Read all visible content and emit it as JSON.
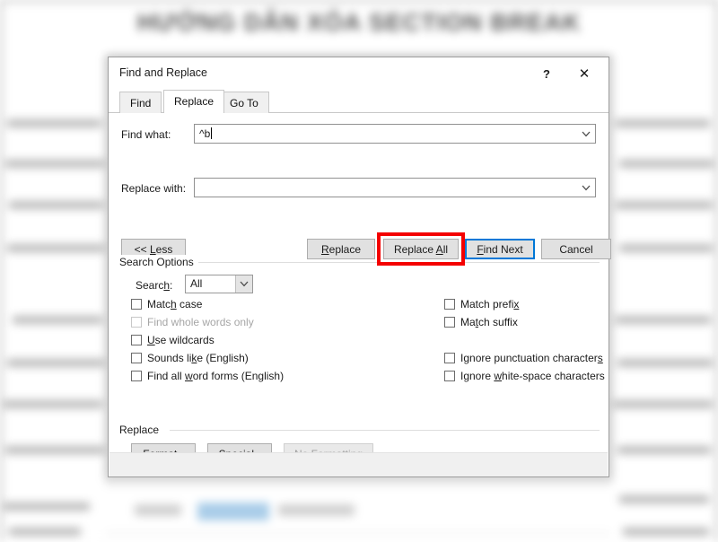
{
  "background": {
    "document_title": "HƯỚNG DẪN XÓA SECTION BREAK"
  },
  "dialog": {
    "title": "Find and Replace",
    "help_icon": "?",
    "close_icon": "✕",
    "tabs": [
      {
        "label": "Find",
        "active": false
      },
      {
        "label": "Replace",
        "active": true
      },
      {
        "label": "Go To",
        "active": false
      }
    ],
    "fields": {
      "find_what_label": "Find what:",
      "find_what_value": "^b",
      "replace_with_label": "Replace with:",
      "replace_with_value": "",
      "dropdown_icon": "chevron-down-icon"
    },
    "buttons": {
      "less": "<< Less",
      "replace": "Replace",
      "replace_all": "Replace All",
      "find_next": "Find Next",
      "cancel": "Cancel"
    },
    "search_options": {
      "group_label": "Search Options",
      "search_label": "Search:",
      "search_value": "All",
      "left_checkboxes": [
        {
          "label": "Match case",
          "checked": false,
          "disabled": false
        },
        {
          "label": "Find whole words only",
          "checked": false,
          "disabled": true
        },
        {
          "label": "Use wildcards",
          "checked": false,
          "disabled": false
        },
        {
          "label": "Sounds like (English)",
          "checked": false,
          "disabled": false
        },
        {
          "label": "Find all word forms (English)",
          "checked": false,
          "disabled": false
        }
      ],
      "right_checkboxes": [
        {
          "label": "Match prefix",
          "checked": false,
          "disabled": false
        },
        {
          "label": "Match suffix",
          "checked": false,
          "disabled": false
        },
        {
          "label": "Ignore punctuation characters",
          "checked": false,
          "disabled": false
        },
        {
          "label": "Ignore white-space characters",
          "checked": false,
          "disabled": false
        }
      ]
    },
    "replace_group": {
      "group_label": "Replace",
      "format_button": "Format",
      "special_button": "Special",
      "no_formatting_button": "No Formatting"
    }
  },
  "annotation": {
    "highlight_color": "#f40000",
    "highlight_target": "Replace All"
  }
}
